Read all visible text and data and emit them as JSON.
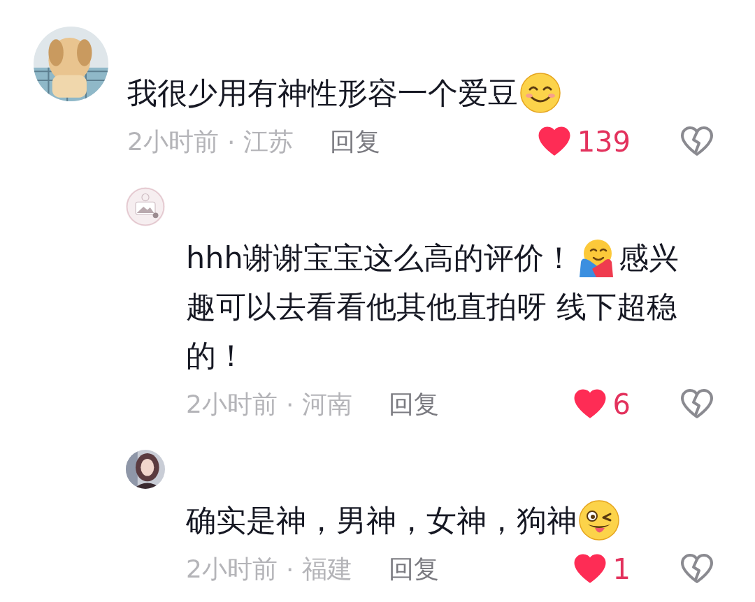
{
  "comments": [
    {
      "reply": false,
      "avatar": {
        "kind": "picture"
      },
      "lines": [
        [
          {
            "kind": "text",
            "text": "我很少用有神性形容一个爱豆"
          },
          {
            "kind": "smile"
          }
        ]
      ],
      "time": "2小时前",
      "separator": "·",
      "location": "江苏",
      "reply_label": "回复",
      "liked": true,
      "likes": "139"
    },
    {
      "reply": true,
      "avatar": {
        "kind": "picture"
      },
      "lines": [
        [
          {
            "kind": "text",
            "text": "hhh谢谢宝宝这么高的评价！"
          },
          {
            "kind": "hug"
          },
          {
            "kind": "text",
            "text": "感兴"
          }
        ],
        [
          {
            "kind": "text",
            "text": "趣可以去看看他其他直拍呀 线下超稳"
          }
        ],
        [
          {
            "kind": "text",
            "text": "的！"
          }
        ]
      ],
      "time": "2小时前",
      "separator": "·",
      "location": "河南",
      "reply_label": "回复",
      "liked": true,
      "likes": "6"
    },
    {
      "reply": true,
      "avatar": {
        "kind": "picture"
      },
      "lines": [
        [
          {
            "kind": "text",
            "text": "确实是神，男神，女神，狗神"
          },
          {
            "kind": "wink"
          }
        ]
      ],
      "time": "2小时前",
      "separator": "·",
      "location": "福建",
      "reply_label": "回复",
      "liked": true,
      "likes": "1"
    }
  ]
}
